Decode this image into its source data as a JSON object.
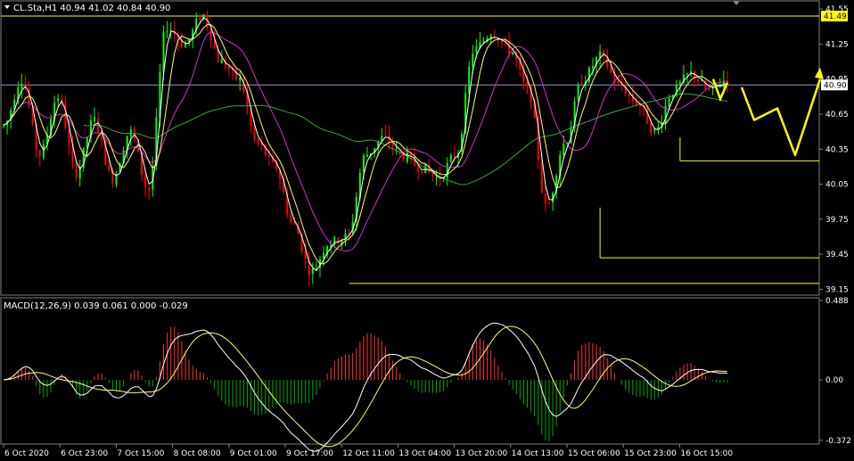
{
  "header": {
    "symbol_info": "CL.Sta,H1  40.94 41.02 40.84 40.90",
    "indicator_info": "MACD(12,26,9) 0.039 0.061 0.000 -0.029"
  },
  "colors": {
    "background": "#000000",
    "bull": "#00ff00",
    "bear": "#ff0000",
    "ma_fast": "#ffffff",
    "ma_mid": "#ffff66",
    "ma_slow": "#cc33cc",
    "ma_long": "#33aa33",
    "level": "#ffff00",
    "current_line": "#9999cc",
    "forecast": "#ffff00",
    "macd_main": "#ffffff",
    "macd_signal": "#ffff66",
    "hist_up": "#ff3333",
    "hist_down": "#00aa00"
  },
  "chart_data": [
    {
      "type": "candlestick",
      "symbol": "CL.Sta",
      "timeframe": "H1",
      "ohlc_current": {
        "open": 40.94,
        "high": 41.02,
        "low": 40.84,
        "close": 40.9
      },
      "price_axis_ticks": [
        "41.55",
        "41.25",
        "40.95",
        "40.65",
        "40.35",
        "40.05",
        "39.75",
        "39.45",
        "39.15"
      ],
      "ylim": [
        39.1,
        41.62
      ],
      "time_labels": [
        "6 Oct 2020",
        "6 Oct 23:00",
        "7 Oct 15:00",
        "8 Oct 08:00",
        "9 Oct 01:00",
        "9 Oct 17:00",
        "12 Oct 11:00",
        "13 Oct 04:00",
        "13 Oct 20:00",
        "14 Oct 13:00",
        "15 Oct 06:00",
        "15 Oct 23:00",
        "16 Oct 15:00"
      ],
      "price_tags": [
        {
          "label": "41.49",
          "value": 41.49,
          "style": "yellow"
        },
        {
          "label": "40.90",
          "value": 40.9,
          "style": "white"
        }
      ],
      "horizontal_levels": [
        41.49,
        40.9,
        40.25,
        39.42,
        39.2
      ],
      "forecast_path": [
        40.88,
        40.6,
        40.7,
        40.3,
        40.95
      ],
      "keypoints": [
        40.55,
        40.95,
        40.3,
        40.8,
        40.15,
        40.6,
        40.1,
        40.5,
        40.0,
        41.4,
        41.25,
        41.5,
        41.1,
        40.95,
        40.4,
        40.2,
        39.7,
        39.3,
        39.55,
        39.6,
        40.3,
        40.45,
        40.3,
        40.2,
        40.1,
        40.3,
        41.2,
        41.35,
        41.2,
        40.85,
        39.85,
        40.4,
        40.95,
        41.15,
        40.9,
        40.75,
        40.5,
        40.85,
        41.0,
        40.85,
        40.95
      ]
    },
    {
      "type": "macd",
      "params": "12,26,9",
      "values": {
        "macd": 0.039,
        "signal": 0.061
      },
      "axis_ticks": [
        "0.488",
        "0.00",
        "-0.372"
      ],
      "ylim": [
        -0.395,
        0.505
      ]
    }
  ]
}
